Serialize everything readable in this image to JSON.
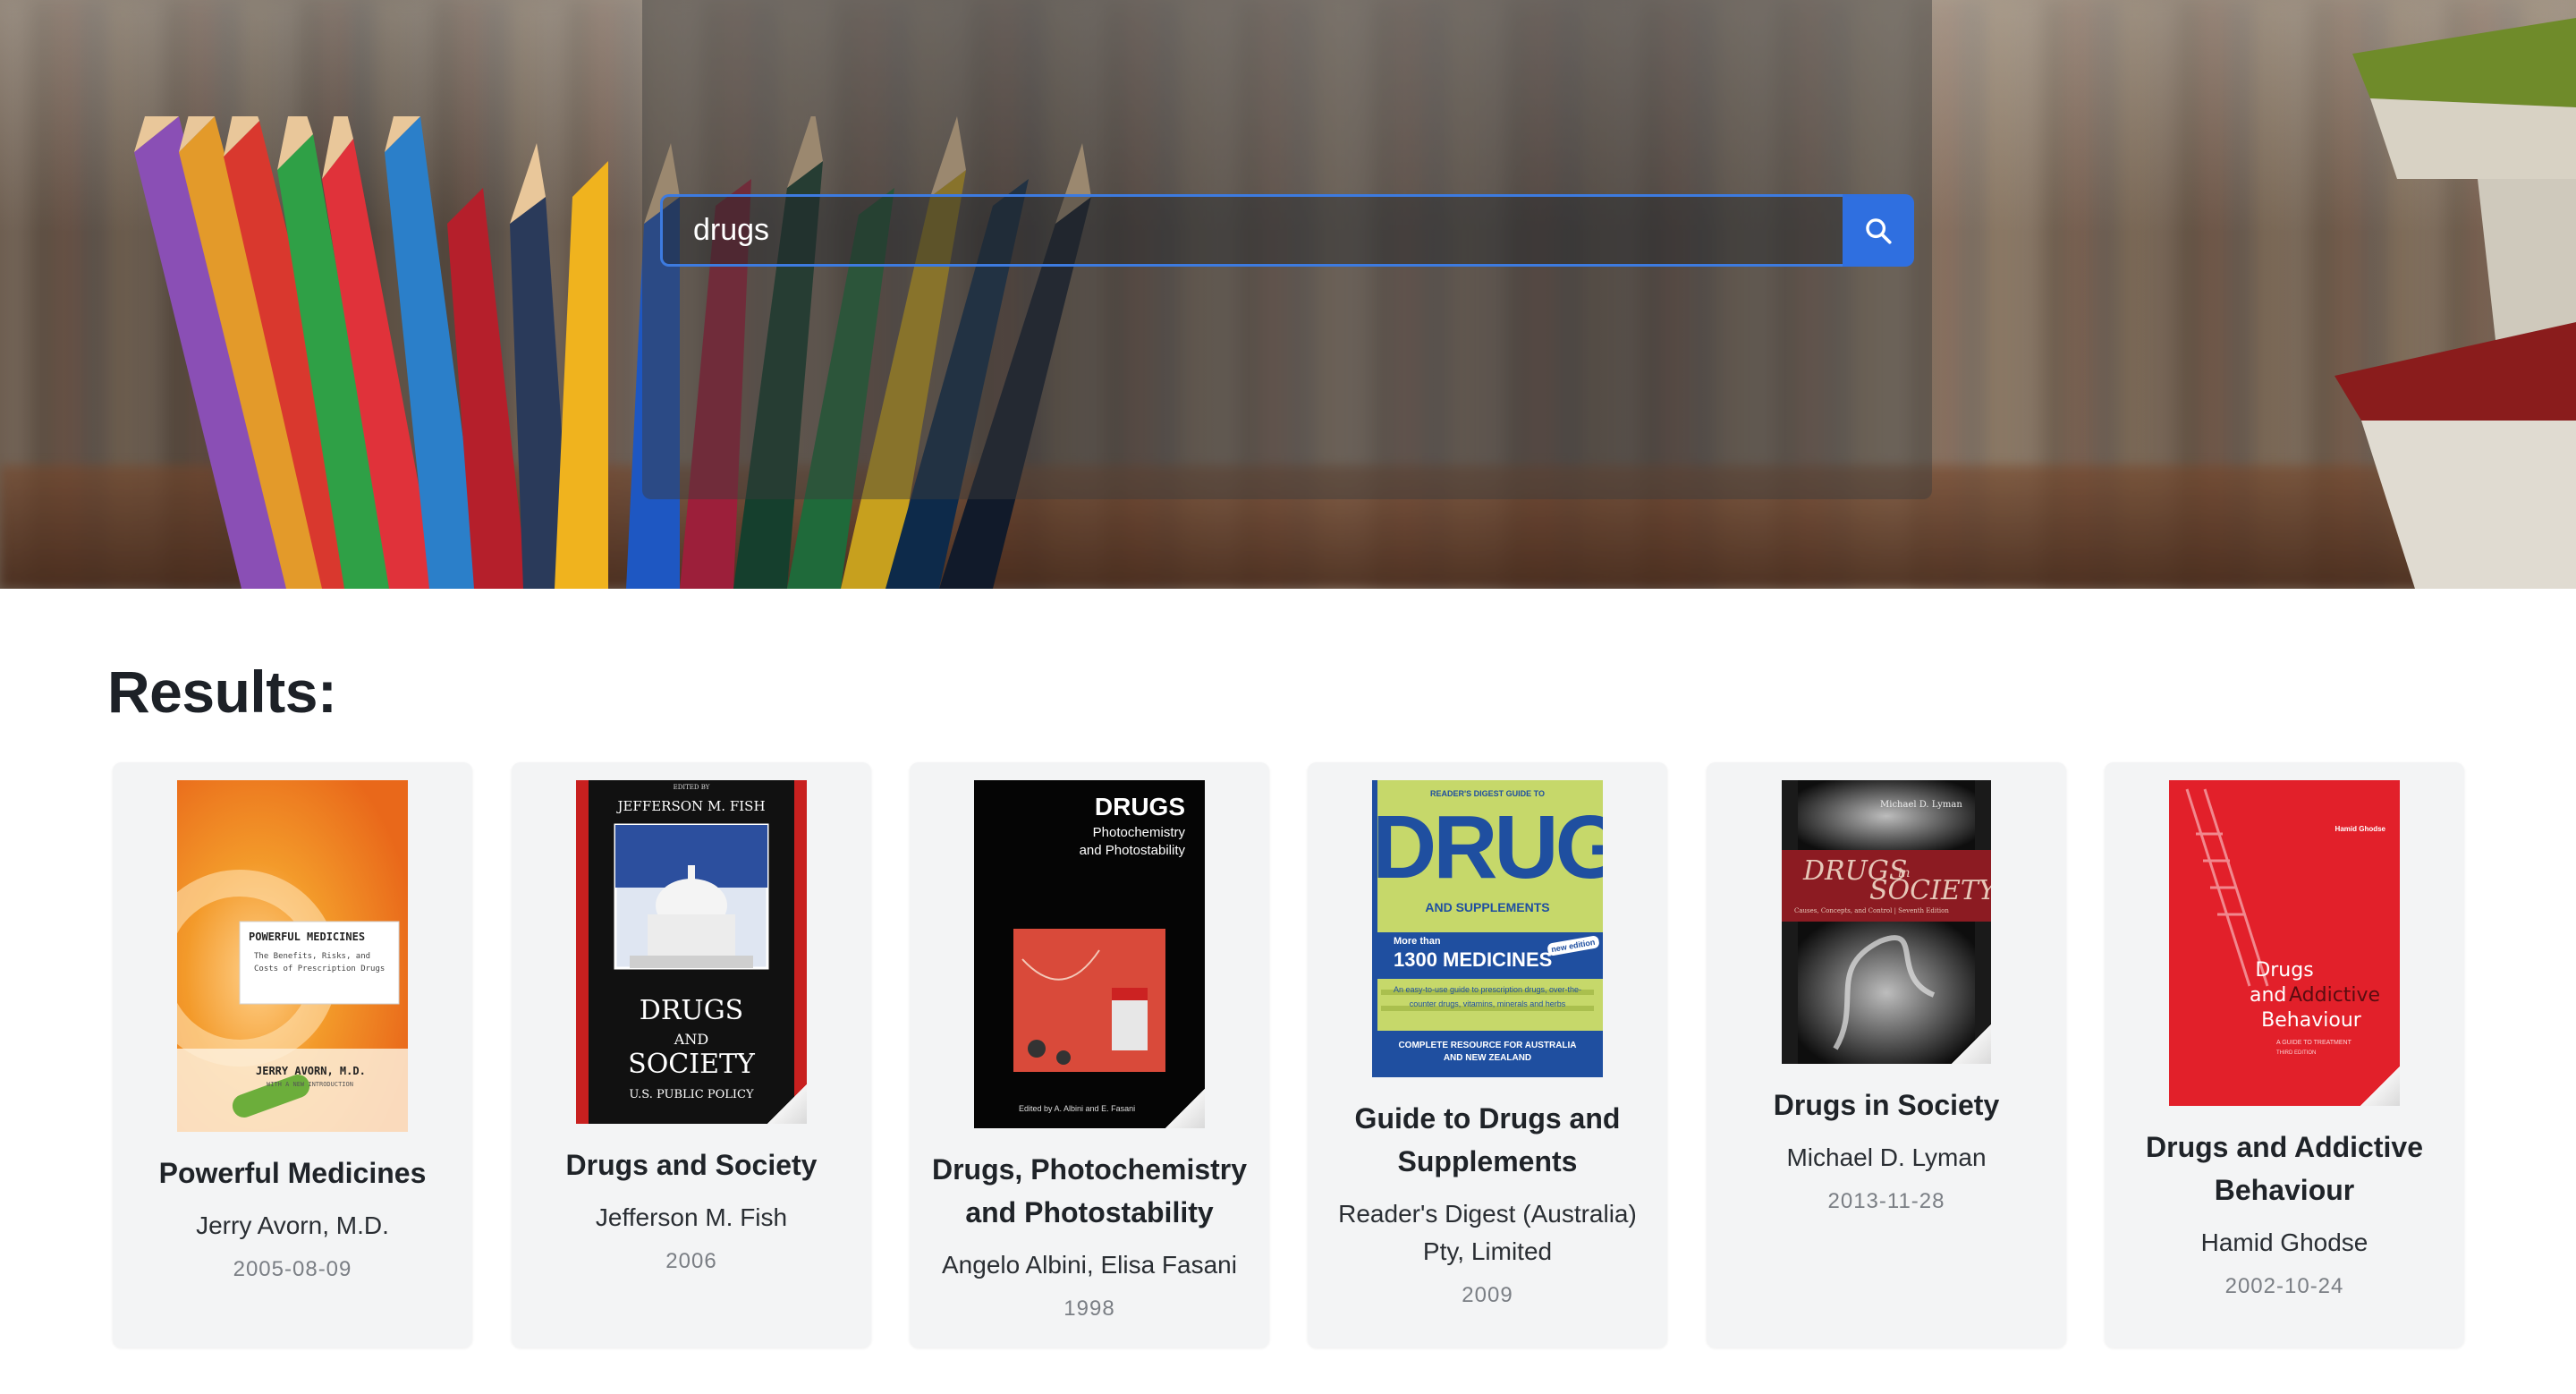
{
  "search": {
    "value": "drugs",
    "button_icon": "search-icon"
  },
  "results": {
    "heading": "Results:",
    "books": [
      {
        "title": "Powerful Medicines",
        "author": "Jerry Avorn, M.D.",
        "date": "2005-08-09",
        "cover": {
          "colors": [
            "#f08a2a",
            "#ffffff",
            "#6cae3b"
          ],
          "t1": "POWERFUL MEDICINES",
          "t2": "The Benefits, Risks, and Costs of Prescription Drugs",
          "t3": "JERRY AVORN, M.D.",
          "t4": "WITH A NEW INTRODUCTION"
        }
      },
      {
        "title": "Drugs and Society",
        "author": "Jefferson M. Fish",
        "date": "2006",
        "cover": {
          "colors": [
            "#111111",
            "#c8201f",
            "#2c4f9e"
          ],
          "t1": "EDITED BY",
          "t2": "JEFFERSON M. FISH",
          "t3": "DRUGS",
          "t4": "AND",
          "t5": "SOCIETY",
          "t6": "U.S. PUBLIC POLICY"
        }
      },
      {
        "title": "Drugs, Photochemistry and Photostability",
        "author": "Angelo Albini, Elisa Fasani",
        "date": "1998",
        "cover": {
          "colors": [
            "#050505",
            "#d94a3a"
          ],
          "t1": "DRUGS",
          "t2": "Photochemistry",
          "t3": "and Photostability",
          "t4": "Edited by A. Albini and E. Fasani"
        }
      },
      {
        "title": "Guide to Drugs and Supplements",
        "author": "Reader's Digest (Australia) Pty, Limited",
        "date": "2009",
        "cover": {
          "colors": [
            "#c6d86a",
            "#1f4fa0"
          ],
          "t1": "READER'S DIGEST GUIDE TO",
          "t2": "DRUGS",
          "t3": "AND SUPPLEMENTS",
          "t4": "More than",
          "t5": "1300 MEDICINES",
          "t6": "new edition",
          "t7": "An easy-to-use guide to prescription drugs, over-the-counter drugs, vitamins, minerals and herbs",
          "t8": "COMPLETE RESOURCE FOR AUSTRALIA AND NEW ZEALAND"
        }
      },
      {
        "title": "Drugs in Society",
        "author": "Michael D. Lyman",
        "date": "2013-11-28",
        "cover": {
          "colors": [
            "#1a1a1a",
            "#8c1b22"
          ],
          "t1": "Michael D. Lyman",
          "t2": "DRUGS",
          "t3": "in",
          "t4": "SOCIETY",
          "t5": "Causes, Concepts, and Control | Seventh Edition"
        }
      },
      {
        "title": "Drugs and Addictive Behaviour",
        "author": "Hamid Ghodse",
        "date": "2002-10-24",
        "cover": {
          "colors": [
            "#e8222b",
            "#ffffff"
          ],
          "t1": "Hamid Ghodse",
          "t2": "Drugs",
          "t3": "and",
          "t4": "Addictive",
          "t5": "Behaviour",
          "t6": "A GUIDE TO TREATMENT",
          "t7": "THIRD EDITION"
        }
      }
    ]
  }
}
